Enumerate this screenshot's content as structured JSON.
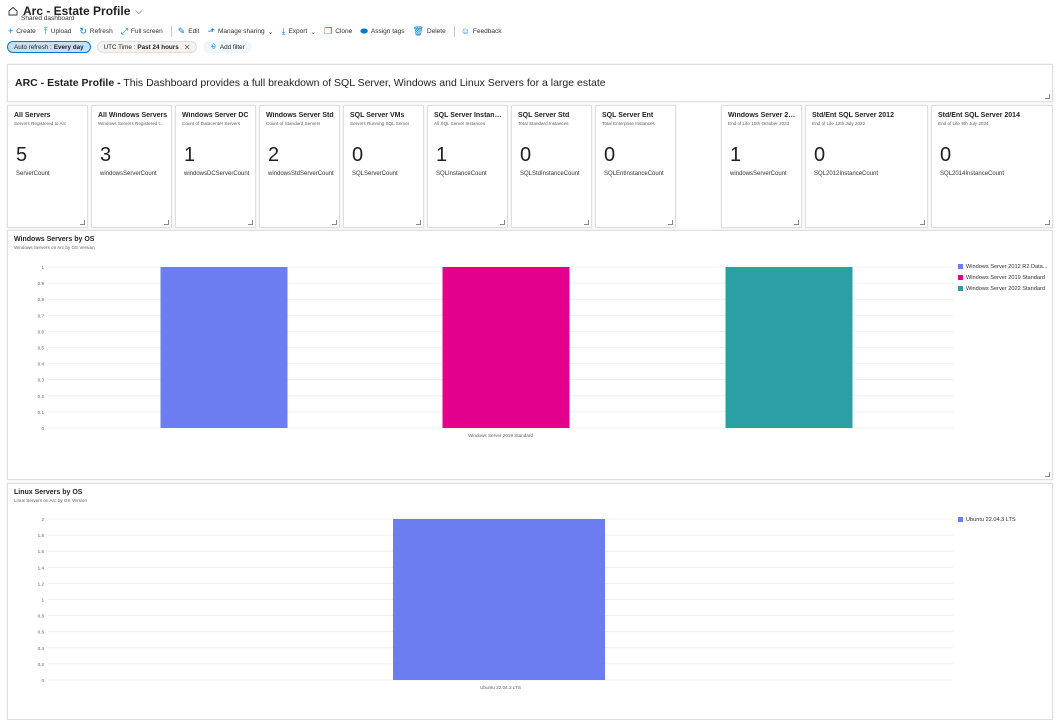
{
  "header": {
    "title": "Arc - Estate Profile",
    "subtitle": "Shared dashboard"
  },
  "toolbar": {
    "create": "Create",
    "upload": "Upload",
    "refresh": "Refresh",
    "fullscreen": "Full screen",
    "edit": "Edit",
    "manage_sharing": "Manage sharing",
    "export": "Export",
    "clone": "Clone",
    "assign_tags": "Assign tags",
    "delete": "Delete",
    "feedback": "Feedback"
  },
  "filters": {
    "auto_refresh_label": "Auto refresh : ",
    "auto_refresh_value": "Every day",
    "time_label": "UTC Time : ",
    "time_value": "Past 24 hours",
    "add_filter": "Add filter"
  },
  "markdown": {
    "bold": "ARC - Estate Profile -",
    "text": " This Dashboard provides a full breakdown of SQL Server, Windows and Linux Servers for a large estate"
  },
  "stats": [
    {
      "title": "All Servers",
      "subtitle": "Servers Registered to Arc",
      "value": "5",
      "label": "ServerCount"
    },
    {
      "title": "All Windows Servers",
      "subtitle": "Windows Servers Registered t...",
      "value": "3",
      "label": "windowsServerCount"
    },
    {
      "title": "Windows Server DC",
      "subtitle": "Count of Datacenter Servers",
      "value": "1",
      "label": "windowsDCServerCount"
    },
    {
      "title": "Windows Server Std",
      "subtitle": "Count of Standard Servers",
      "value": "2",
      "label": "windowsStdServerCount"
    },
    {
      "title": "SQL Server VMs",
      "subtitle": "Servers Running SQL Server",
      "value": "0",
      "label": "SQLServerCount"
    },
    {
      "title": "SQL Server Instances",
      "subtitle": "All SQL Server Instances",
      "value": "1",
      "label": "SQLInstanceCount"
    },
    {
      "title": "SQL Server Std",
      "subtitle": "Total Standard Instances",
      "value": "0",
      "label": "SQLStdInstanceCount"
    },
    {
      "title": "SQL Server Ent",
      "subtitle": "Total Enterprise Instances",
      "value": "0",
      "label": "SQLEntInstanceCount"
    },
    {
      "title": "Windows Server 2012",
      "subtitle": "End of Life 10th October 2023",
      "value": "1",
      "label": "windowsServerCount"
    },
    {
      "title": "Std/Ent SQL Server 2012",
      "subtitle": "End of Life 12th July 2022",
      "value": "0",
      "label": "SQL2012InstanceCount"
    },
    {
      "title": "Std/Ent SQL Server 2014",
      "subtitle": "End of Life 9th July 2024",
      "value": "0",
      "label": "SQL2014InstanceCount"
    }
  ],
  "chart_data": [
    {
      "type": "bar",
      "title": "Windows Servers by OS",
      "subtitle": "Windows Servers on Arc by OS Version",
      "x_tick_label": "Windows Server 2019 Standard",
      "ylim": [
        0,
        1
      ],
      "y_ticks": [
        "1",
        "0.9",
        "0.8",
        "0.7",
        "0.6",
        "0.5",
        "0.4",
        "0.3",
        "0.2",
        "0.1",
        "0"
      ],
      "grid": true,
      "legend_position": "right",
      "series": [
        {
          "name": "Windows Server 2012 R2 Data...",
          "value": 1,
          "color": "#6b7df0"
        },
        {
          "name": "Windows Server 2019 Standard",
          "value": 1,
          "color": "#e3008c"
        },
        {
          "name": "Windows Server 2022 Standard",
          "value": 1,
          "color": "#2aa0a4"
        }
      ]
    },
    {
      "type": "bar",
      "title": "Linux Servers by OS",
      "subtitle": "Linux Servers on Arc by OS Version",
      "x_tick_label": "Ubuntu 22.04.3 LTS",
      "ylim": [
        0,
        2
      ],
      "y_ticks": [
        "2",
        "1.8",
        "1.6",
        "1.4",
        "1.2",
        "1",
        "0.8",
        "0.6",
        "0.4",
        "0.2",
        "0"
      ],
      "grid": true,
      "legend_position": "right",
      "series": [
        {
          "name": "Ubuntu 22.04.3 LTS",
          "value": 2,
          "color": "#6b7df0"
        }
      ]
    }
  ]
}
